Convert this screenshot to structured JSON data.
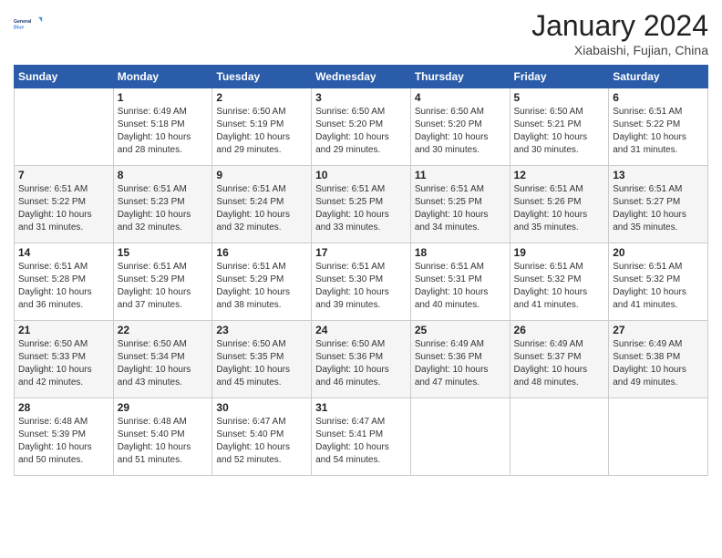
{
  "header": {
    "logo_general": "General",
    "logo_blue": "Blue",
    "month_title": "January 2024",
    "location": "Xiabaishi, Fujian, China"
  },
  "weekdays": [
    "Sunday",
    "Monday",
    "Tuesday",
    "Wednesday",
    "Thursday",
    "Friday",
    "Saturday"
  ],
  "weeks": [
    [
      {
        "day": "",
        "info": ""
      },
      {
        "day": "1",
        "info": "Sunrise: 6:49 AM\nSunset: 5:18 PM\nDaylight: 10 hours\nand 28 minutes."
      },
      {
        "day": "2",
        "info": "Sunrise: 6:50 AM\nSunset: 5:19 PM\nDaylight: 10 hours\nand 29 minutes."
      },
      {
        "day": "3",
        "info": "Sunrise: 6:50 AM\nSunset: 5:20 PM\nDaylight: 10 hours\nand 29 minutes."
      },
      {
        "day": "4",
        "info": "Sunrise: 6:50 AM\nSunset: 5:20 PM\nDaylight: 10 hours\nand 30 minutes."
      },
      {
        "day": "5",
        "info": "Sunrise: 6:50 AM\nSunset: 5:21 PM\nDaylight: 10 hours\nand 30 minutes."
      },
      {
        "day": "6",
        "info": "Sunrise: 6:51 AM\nSunset: 5:22 PM\nDaylight: 10 hours\nand 31 minutes."
      }
    ],
    [
      {
        "day": "7",
        "info": "Sunrise: 6:51 AM\nSunset: 5:22 PM\nDaylight: 10 hours\nand 31 minutes."
      },
      {
        "day": "8",
        "info": "Sunrise: 6:51 AM\nSunset: 5:23 PM\nDaylight: 10 hours\nand 32 minutes."
      },
      {
        "day": "9",
        "info": "Sunrise: 6:51 AM\nSunset: 5:24 PM\nDaylight: 10 hours\nand 32 minutes."
      },
      {
        "day": "10",
        "info": "Sunrise: 6:51 AM\nSunset: 5:25 PM\nDaylight: 10 hours\nand 33 minutes."
      },
      {
        "day": "11",
        "info": "Sunrise: 6:51 AM\nSunset: 5:25 PM\nDaylight: 10 hours\nand 34 minutes."
      },
      {
        "day": "12",
        "info": "Sunrise: 6:51 AM\nSunset: 5:26 PM\nDaylight: 10 hours\nand 35 minutes."
      },
      {
        "day": "13",
        "info": "Sunrise: 6:51 AM\nSunset: 5:27 PM\nDaylight: 10 hours\nand 35 minutes."
      }
    ],
    [
      {
        "day": "14",
        "info": "Sunrise: 6:51 AM\nSunset: 5:28 PM\nDaylight: 10 hours\nand 36 minutes."
      },
      {
        "day": "15",
        "info": "Sunrise: 6:51 AM\nSunset: 5:29 PM\nDaylight: 10 hours\nand 37 minutes."
      },
      {
        "day": "16",
        "info": "Sunrise: 6:51 AM\nSunset: 5:29 PM\nDaylight: 10 hours\nand 38 minutes."
      },
      {
        "day": "17",
        "info": "Sunrise: 6:51 AM\nSunset: 5:30 PM\nDaylight: 10 hours\nand 39 minutes."
      },
      {
        "day": "18",
        "info": "Sunrise: 6:51 AM\nSunset: 5:31 PM\nDaylight: 10 hours\nand 40 minutes."
      },
      {
        "day": "19",
        "info": "Sunrise: 6:51 AM\nSunset: 5:32 PM\nDaylight: 10 hours\nand 41 minutes."
      },
      {
        "day": "20",
        "info": "Sunrise: 6:51 AM\nSunset: 5:32 PM\nDaylight: 10 hours\nand 41 minutes."
      }
    ],
    [
      {
        "day": "21",
        "info": "Sunrise: 6:50 AM\nSunset: 5:33 PM\nDaylight: 10 hours\nand 42 minutes."
      },
      {
        "day": "22",
        "info": "Sunrise: 6:50 AM\nSunset: 5:34 PM\nDaylight: 10 hours\nand 43 minutes."
      },
      {
        "day": "23",
        "info": "Sunrise: 6:50 AM\nSunset: 5:35 PM\nDaylight: 10 hours\nand 45 minutes."
      },
      {
        "day": "24",
        "info": "Sunrise: 6:50 AM\nSunset: 5:36 PM\nDaylight: 10 hours\nand 46 minutes."
      },
      {
        "day": "25",
        "info": "Sunrise: 6:49 AM\nSunset: 5:36 PM\nDaylight: 10 hours\nand 47 minutes."
      },
      {
        "day": "26",
        "info": "Sunrise: 6:49 AM\nSunset: 5:37 PM\nDaylight: 10 hours\nand 48 minutes."
      },
      {
        "day": "27",
        "info": "Sunrise: 6:49 AM\nSunset: 5:38 PM\nDaylight: 10 hours\nand 49 minutes."
      }
    ],
    [
      {
        "day": "28",
        "info": "Sunrise: 6:48 AM\nSunset: 5:39 PM\nDaylight: 10 hours\nand 50 minutes."
      },
      {
        "day": "29",
        "info": "Sunrise: 6:48 AM\nSunset: 5:40 PM\nDaylight: 10 hours\nand 51 minutes."
      },
      {
        "day": "30",
        "info": "Sunrise: 6:47 AM\nSunset: 5:40 PM\nDaylight: 10 hours\nand 52 minutes."
      },
      {
        "day": "31",
        "info": "Sunrise: 6:47 AM\nSunset: 5:41 PM\nDaylight: 10 hours\nand 54 minutes."
      },
      {
        "day": "",
        "info": ""
      },
      {
        "day": "",
        "info": ""
      },
      {
        "day": "",
        "info": ""
      }
    ]
  ]
}
